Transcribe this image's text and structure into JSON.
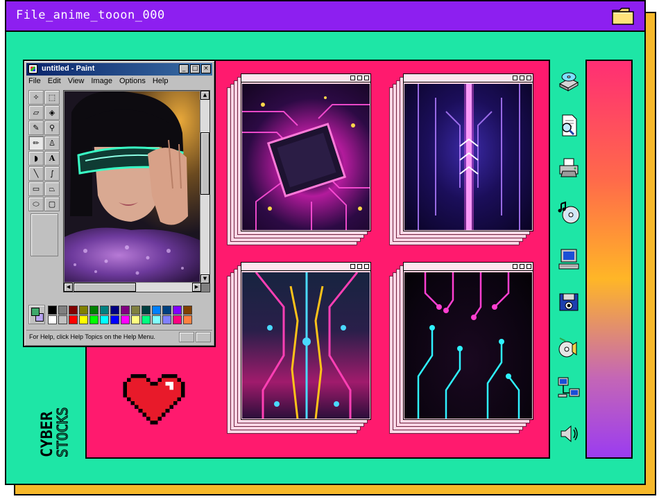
{
  "window": {
    "title": "File_anime_tooon_000",
    "folder_icon": "folder-icon"
  },
  "paint": {
    "title": "untitled - Paint",
    "menu": [
      "File",
      "Edit",
      "View",
      "Image",
      "Options",
      "Help"
    ],
    "status": "For Help, click Help Topics on the Help Menu.",
    "tools": [
      "free-select",
      "rect-select",
      "eraser",
      "fill",
      "eyedropper",
      "magnifier",
      "pencil",
      "brush",
      "airbrush",
      "text",
      "line",
      "curve",
      "rectangle",
      "polygon",
      "ellipse",
      "rounded-rect"
    ],
    "palette_top": [
      "#000000",
      "#808080",
      "#800000",
      "#808000",
      "#008000",
      "#008080",
      "#000080",
      "#800080",
      "#808040",
      "#004040",
      "#0080ff",
      "#004080",
      "#8000ff",
      "#804000"
    ],
    "palette_bottom": [
      "#ffffff",
      "#c0c0c0",
      "#ff0000",
      "#ffff00",
      "#00ff00",
      "#00ffff",
      "#0000ff",
      "#ff00ff",
      "#ffff80",
      "#00ff80",
      "#80ffff",
      "#8080ff",
      "#ff0080",
      "#ff8040"
    ],
    "fg_color": "#3ea86b",
    "bg_color": "#b7a3f0"
  },
  "gallery": {
    "images": [
      "circuit-chip",
      "circuit-corridor",
      "circuit-symmetric",
      "circuit-neon-lines"
    ]
  },
  "desktop_icons": [
    "cd-drive-icon",
    "search-document-icon",
    "printer-icon",
    "music-cd-icon",
    "computer-icon",
    "camera-floppy-icon",
    "sound-cd-icon",
    "network-icon",
    "speaker-icon"
  ],
  "branding": {
    "line1": "CYBER",
    "line2": "STOCKS"
  },
  "colors": {
    "background": "#1ee6a6",
    "titlebar": "#8d1ff0",
    "panel": "#ff1a6e",
    "shadow": "#f6b82a",
    "heart": "#e81a2a"
  }
}
